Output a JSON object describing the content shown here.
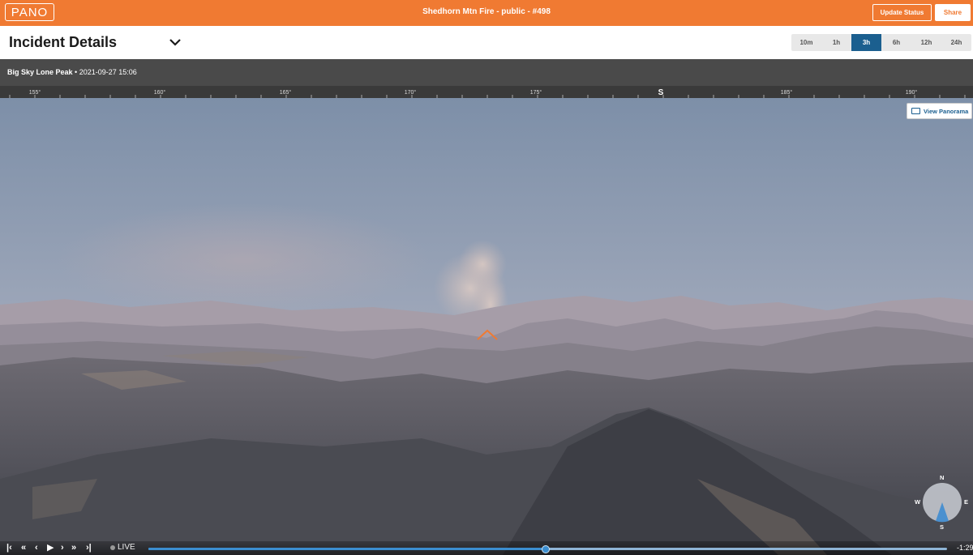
{
  "topbar": {
    "logo": "PANO",
    "title": "Shedhorn Mtn Fire - public - #498",
    "update_status": "Update Status",
    "share": "Share"
  },
  "details": {
    "title": "Incident Details",
    "ranges": [
      "10m",
      "1h",
      "3h",
      "6h",
      "12h",
      "24h"
    ],
    "active_range": "3h"
  },
  "camera": {
    "name": "Big Sky Lone Peak",
    "separator": " • ",
    "timestamp": "2021-09-27 15:06"
  },
  "ruler": {
    "labels": [
      "155°",
      "160°",
      "165°",
      "170°",
      "175°",
      "S",
      "185°",
      "190°"
    ]
  },
  "view_panorama": "View Panorama",
  "compass": {
    "n": "N",
    "e": "E",
    "s": "S",
    "w": "W"
  },
  "playback": {
    "live": "LIVE",
    "time_remaining": "-1:29",
    "progress_fraction": 0.497
  },
  "colors": {
    "brand": "#f07a32",
    "active": "#1b5f8f",
    "progress": "#3b8ed0"
  }
}
